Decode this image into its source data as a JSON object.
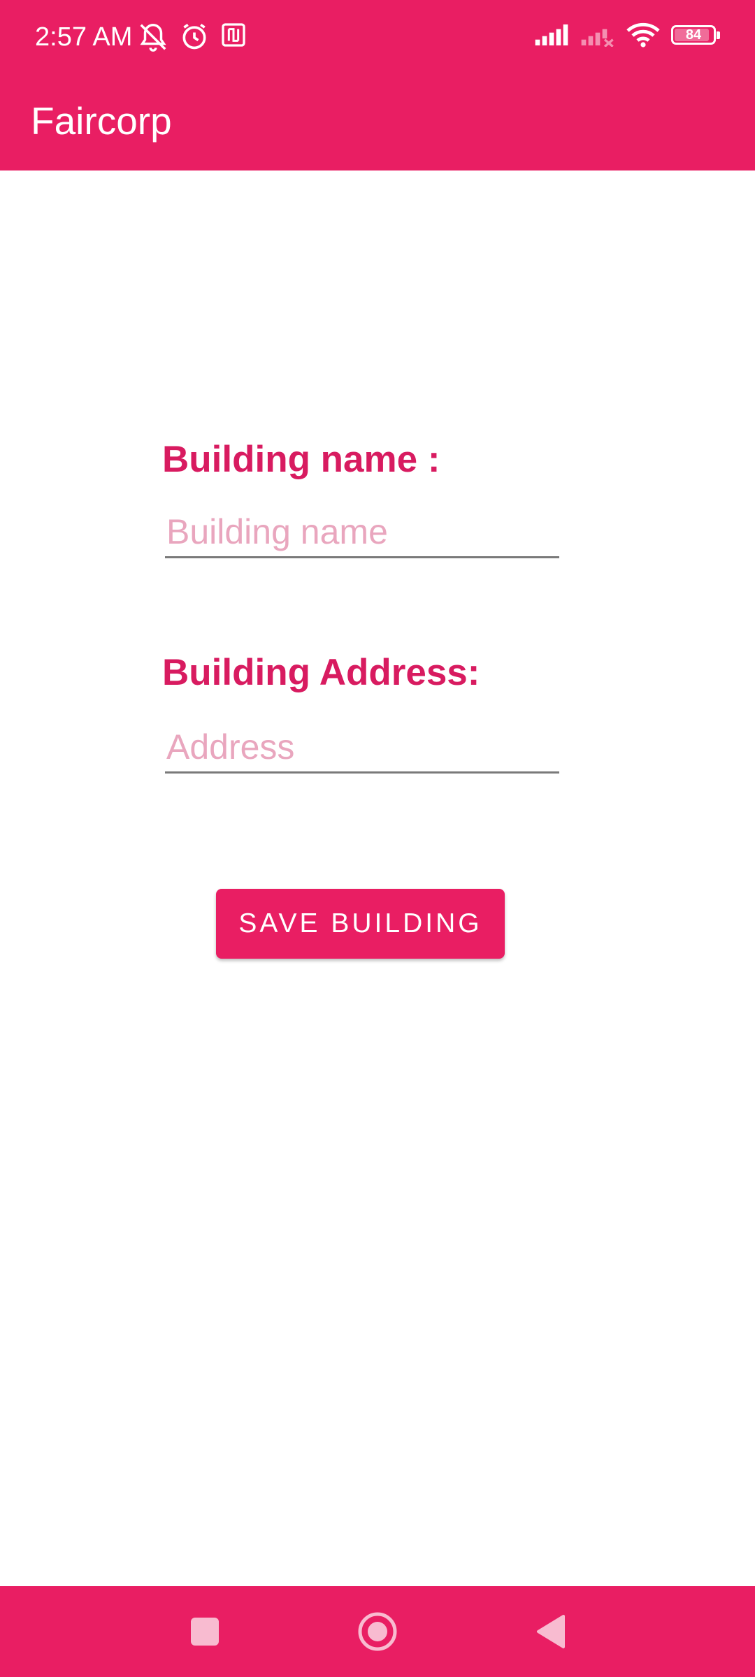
{
  "status_bar": {
    "time": "2:57 AM",
    "battery": "84",
    "left_icons": [
      "muted-bell-icon",
      "alarm-icon",
      "nfc-icon"
    ],
    "right_icons": [
      "signal-icon",
      "signal-off-icon",
      "wifi-icon",
      "battery-icon"
    ]
  },
  "app_bar": {
    "title": "Faircorp"
  },
  "form": {
    "name_label": "Building name :",
    "name_placeholder": "Building name",
    "name_value": "",
    "address_label": "Building Address:",
    "address_placeholder": "Address",
    "address_value": "",
    "save_label": "SAVE BUILDING"
  },
  "nav_bar": {
    "icons": [
      "recents-square-icon",
      "home-circle-icon",
      "back-triangle-icon"
    ]
  },
  "colors": {
    "accent": "#E91E63",
    "label": "#D81B60",
    "placeholder": "#E9A6BE",
    "background": "#FFFFFF"
  }
}
